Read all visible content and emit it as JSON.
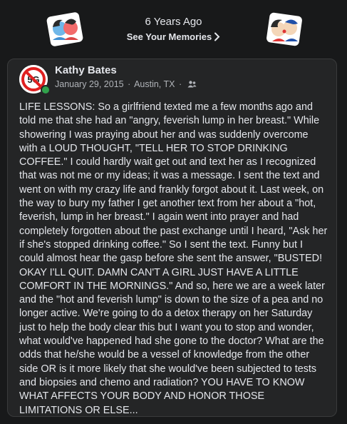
{
  "memories": {
    "years_ago": "6 Years Ago",
    "link_label": "See Your Memories"
  },
  "post": {
    "author": "Kathy Bates",
    "date": "January 29, 2015",
    "separator": "·",
    "location": "Austin, TX",
    "audience_icon": "friends-icon",
    "text": "LIFE LESSONS:  So a girlfriend texted me a few months ago and told me that she had an \"angry, feverish lump in her breast.\"  While showering I was praying about her and was suddenly overcome with a LOUD THOUGHT, \"TELL HER TO STOP DRINKING COFFEE.\"  I could hardly wait get out and text her as I recognized that was not me or my ideas; it was a message.  I sent the text and went on with my crazy life and frankly forgot about it.  Last week, on the way to bury my father I get another text from her about a \"hot, feverish, lump in her breast.\"  I again went into prayer and had completely forgotten about the past exchange until I heard, \"Ask her if she's stopped drinking coffee.\"  So I sent the text. Funny but I could almost hear the gasp before she sent the answer, \"BUSTED!  OKAY I'LL QUIT.  DAMN CAN'T A GIRL JUST HAVE A LITTLE COMFORT IN THE MORNINGS.\"  And so, here we are a week later and the \"hot and feverish lump\" is down to the size of a pea and no longer active.  We're going to do a detox therapy on her Saturday just to help the body clear this but I want you to stop and wonder, what would've happened had she gone to the doctor?  What are the odds that he/she would be a vessel of knowledge from the other side OR is it more likely that she would've been subjected to tests and biopsies and chemo and radiation?  YOU HAVE TO KNOW WHAT AFFECTS YOUR BODY AND HONOR THOSE LIMITATIONS OR ELSE..."
  },
  "colors": {
    "background": "#18191a",
    "card": "#242526",
    "primary_text": "#e4e6eb",
    "secondary_text": "#b0b3b8",
    "online": "#31a24c"
  }
}
